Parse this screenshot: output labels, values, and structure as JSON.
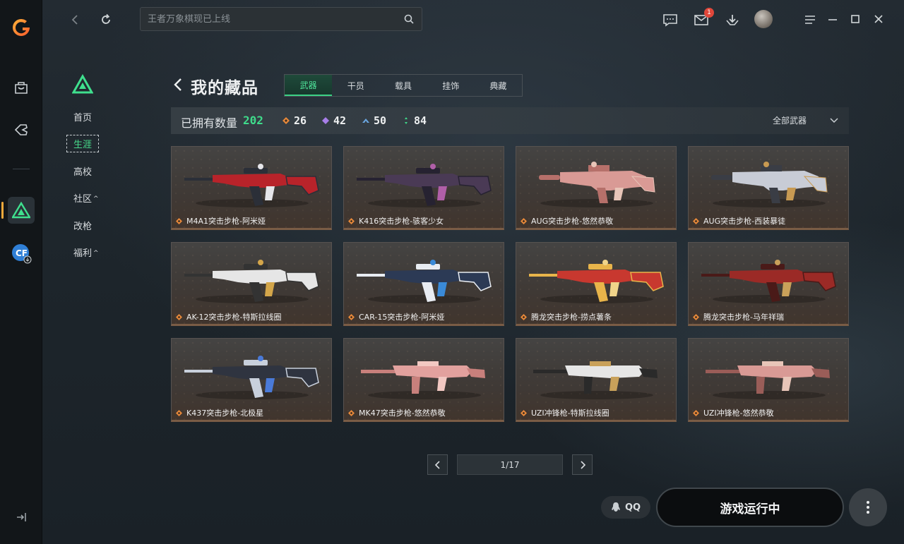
{
  "search": {
    "placeholder": "王者万象棋现已上线"
  },
  "topbar": {
    "mail_badge": "1"
  },
  "subnav": {
    "items": [
      {
        "label": "首页"
      },
      {
        "label": "生涯"
      },
      {
        "label": "高校"
      },
      {
        "label": "社区",
        "caret": "^"
      },
      {
        "label": "改枪"
      },
      {
        "label": "福利",
        "caret": "^"
      }
    ]
  },
  "page": {
    "title": "我的藏品",
    "tabs": [
      {
        "label": "武器"
      },
      {
        "label": "干员"
      },
      {
        "label": "载具"
      },
      {
        "label": "挂饰"
      },
      {
        "label": "典藏"
      }
    ]
  },
  "stats": {
    "label": "已拥有数量",
    "total": "202",
    "counts": [
      {
        "value": "26",
        "color": "#e8893a"
      },
      {
        "value": "42",
        "color": "#a77ee8"
      },
      {
        "value": "50",
        "color": "#6aa6e0"
      },
      {
        "value": "84",
        "color": "#3fd88a"
      }
    ],
    "filter": "全部武器"
  },
  "items": [
    {
      "name": "M4A1突击步枪-阿米娅",
      "palette": [
        "#b8232a",
        "#2b2f38",
        "#e6e6ea"
      ]
    },
    {
      "name": "K416突击步枪-骇客少女",
      "palette": [
        "#4a3a55",
        "#262231",
        "#b05fa8"
      ]
    },
    {
      "name": "AUG突击步枪-悠然恭敬",
      "palette": [
        "#d99a95",
        "#b6706a",
        "#e8c5b8"
      ]
    },
    {
      "name": "AUG突击步枪-西装暴徒",
      "palette": [
        "#c8ccd6",
        "#3a3d45",
        "#c89a52"
      ]
    },
    {
      "name": "AK-12突击步枪-特斯拉线圈",
      "palette": [
        "#e6e6e6",
        "#333",
        "#d4a64a"
      ]
    },
    {
      "name": "CAR-15突击步枪-阿米娅",
      "palette": [
        "#2c3a55",
        "#e8ecf2",
        "#3a8ad8"
      ]
    },
    {
      "name": "腾龙突击步枪-捞点薯条",
      "palette": [
        "#c8382f",
        "#e8b44a",
        "#f0d48a"
      ]
    },
    {
      "name": "腾龙突击步枪-马年祥瑞",
      "palette": [
        "#9b2a26",
        "#4a1a18",
        "#c9a15a"
      ]
    },
    {
      "name": "K437突击步枪-北极星",
      "palette": [
        "#2f3440",
        "#c8d0dc",
        "#4a7ad8"
      ]
    },
    {
      "name": "MK47突击步枪-悠然恭敬",
      "palette": [
        "#e2a19e",
        "#c8807c",
        "#f2c8c2"
      ]
    },
    {
      "name": "UZI冲锋枪-特斯拉线圈",
      "palette": [
        "#e6e6e6",
        "#2a2a2a",
        "#c9a15a"
      ]
    },
    {
      "name": "UZI冲锋枪-悠然恭敬",
      "palette": [
        "#d99a95",
        "#9a5d58",
        "#e8c5b8"
      ]
    }
  ],
  "pagination": {
    "page": "1/17"
  },
  "bottom": {
    "qq_label": "QQ",
    "launch_label": "游戏运行中"
  }
}
